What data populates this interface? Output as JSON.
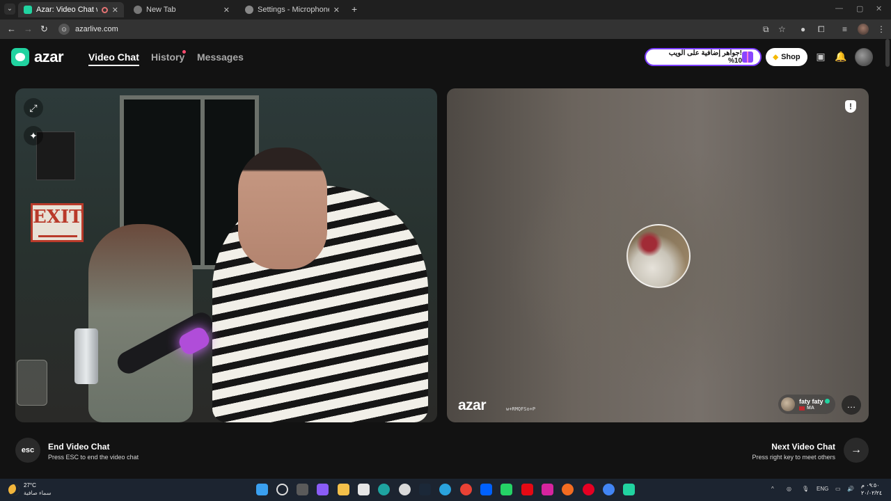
{
  "browser": {
    "tabs": [
      {
        "title": "Azar: Video Chat with New",
        "active": true
      },
      {
        "title": "New Tab",
        "active": false
      },
      {
        "title": "Settings - Microphone",
        "active": false
      }
    ],
    "url": "azarlive.com"
  },
  "header": {
    "logo": "azar",
    "nav": [
      {
        "label": "Video Chat",
        "active": true
      },
      {
        "label": "History",
        "active": false,
        "badge": true
      },
      {
        "label": "Messages",
        "active": false
      }
    ],
    "promo_text": "!جواهر إضافية على الويب 10%",
    "shop_label": "Shop"
  },
  "local_video": {
    "exit_sign": "EXIT"
  },
  "remote_video": {
    "watermark": "azar",
    "watermark_id": "w+RMQFSo+P",
    "user_name": "faty faty",
    "country": "MA"
  },
  "controls": {
    "esc_label": "esc",
    "end_title": "End Video Chat",
    "end_sub": "Press ESC to end the video chat",
    "next_title": "Next Video Chat",
    "next_sub": "Press right key to meet others"
  },
  "taskbar": {
    "temperature": "27°C",
    "weather": "سماء صافية",
    "language": "ENG",
    "time": "٠٩:٥٠ م",
    "date": "٢٠/٠٢/٢٤"
  },
  "colors": {
    "brand": "#21d3a0",
    "promo_border": "#7b3cff",
    "background": "#121212"
  }
}
